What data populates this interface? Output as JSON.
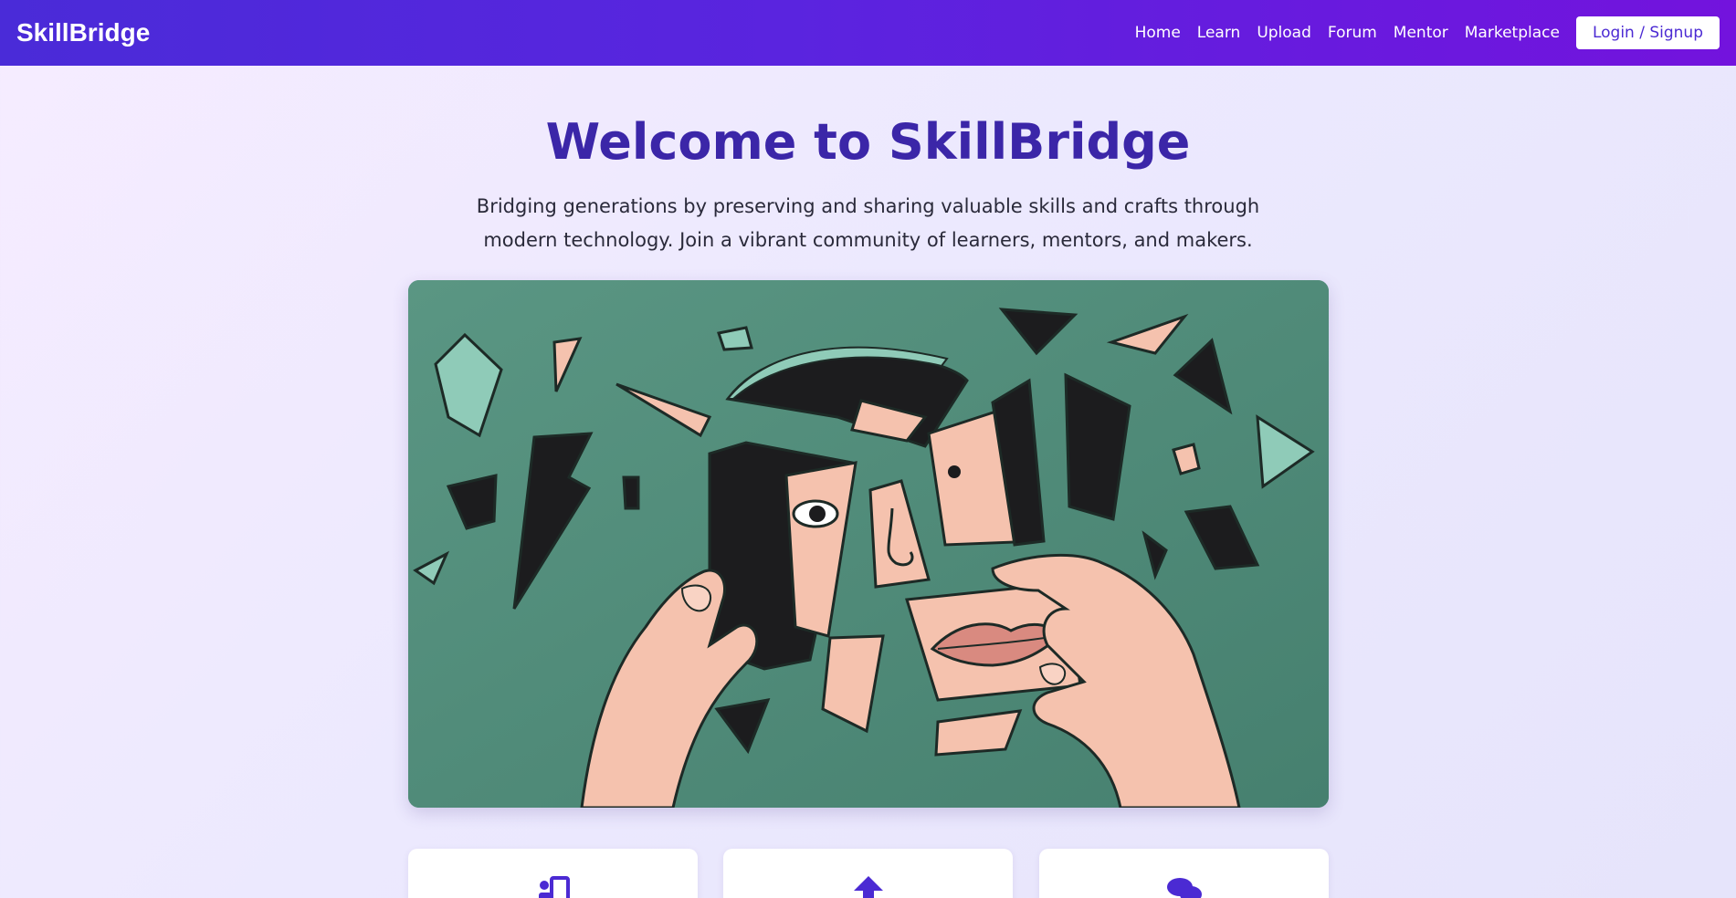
{
  "nav": {
    "brand": "SkillBridge",
    "links": [
      "Home",
      "Learn",
      "Upload",
      "Forum",
      "Mentor",
      "Marketplace"
    ],
    "login_label": "Login / Signup"
  },
  "hero": {
    "title": "Welcome to SkillBridge",
    "subtitle": "Bridging generations by preserving and sharing valuable skills and crafts through modern technology. Join a vibrant community of learners, mentors, and makers.",
    "image_icon": "shattered-face-collage-illustration"
  },
  "feature_cards": [
    {
      "icon": "learn-icon"
    },
    {
      "icon": "upload-arrow-icon"
    },
    {
      "icon": "forum-chat-icon"
    }
  ],
  "colors": {
    "nav_start": "#4a2bd8",
    "nav_end": "#7313dd",
    "title": "#3b26a8",
    "accent": "#4b2ad3"
  }
}
